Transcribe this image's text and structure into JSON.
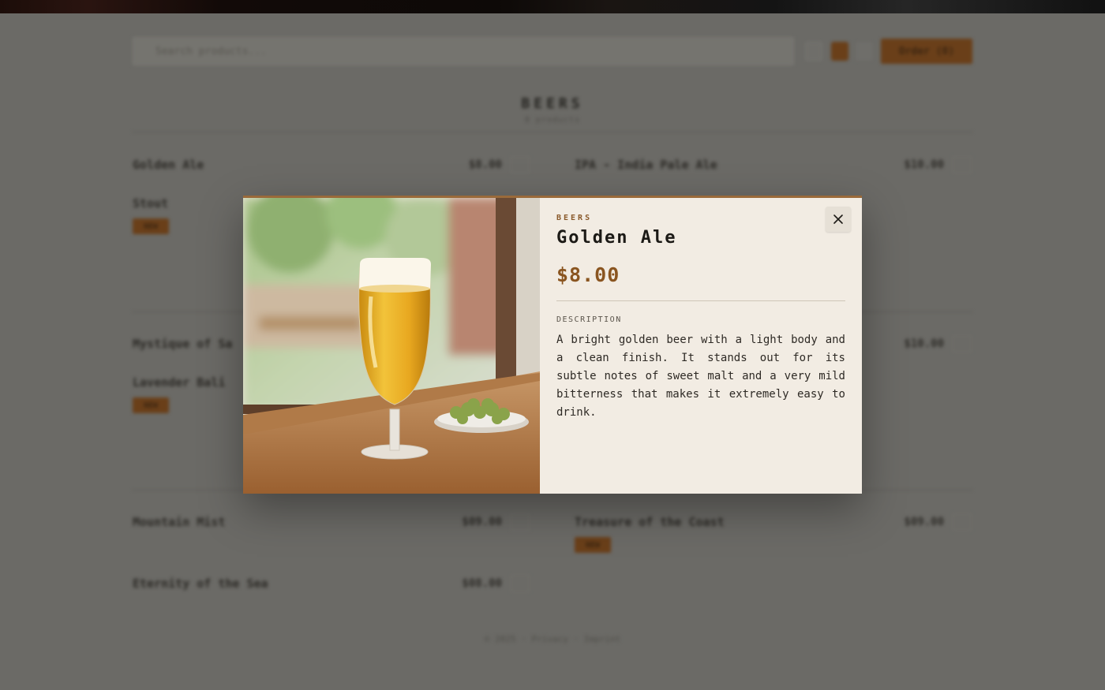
{
  "search": {
    "placeholder": "Search products..."
  },
  "toolbar": {
    "order_label": "Order (0)"
  },
  "category": {
    "title": "BEERS",
    "subtitle": "8 products"
  },
  "products": [
    {
      "name": "Golden Ale",
      "price": "$8.00",
      "tag": ""
    },
    {
      "name": "IPA - India Pale Ale",
      "price": "$10.00",
      "tag": ""
    },
    {
      "name": "Stout",
      "price": "",
      "tag": "NEW"
    },
    {
      "name": "Mystique of Sa",
      "price": "",
      "tag": ""
    },
    {
      "name": "Lavender Bali",
      "price": "",
      "tag": "NEW"
    },
    {
      "name": "",
      "price": "$10.00",
      "tag": ""
    },
    {
      "name": "Mountain Mist",
      "price": "$09.00",
      "tag": ""
    },
    {
      "name": "Treasure of the Coast",
      "price": "$09.00",
      "tag": "NEW"
    },
    {
      "name": "Eternity of the Sea",
      "price": "$08.00",
      "tag": ""
    }
  ],
  "footer": {
    "text": "© 2025 · Privacy · Imprint"
  },
  "modal": {
    "category": "BEERS",
    "title": "Golden Ale",
    "price": "$8.00",
    "description_label": "DESCRIPTION",
    "description": "A bright golden beer with a light body and a clean finish. It stands out for its subtle notes of sweet malt and a very mild bitterness that makes it extremely easy to drink.",
    "close_icon": "close-icon",
    "image_alt": "beer-glass-photo"
  },
  "colors": {
    "accent": "#8a5520",
    "modal_bg": "#f2ece3",
    "overlay": "#6b6a66"
  }
}
